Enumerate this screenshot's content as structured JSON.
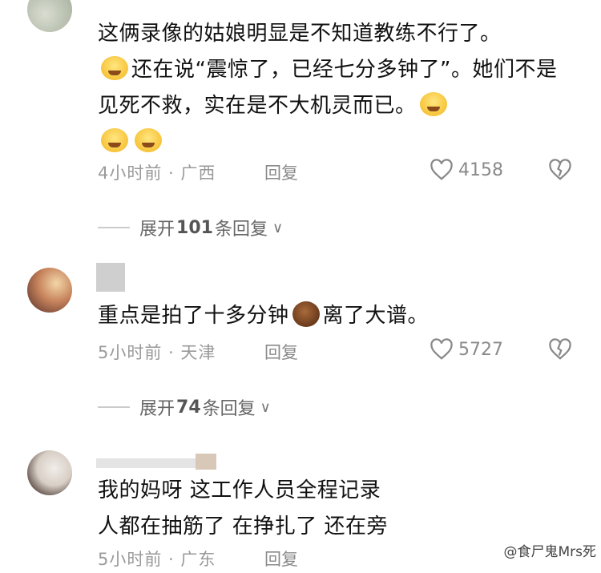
{
  "comments": [
    {
      "text_parts": [
        "这俩录像的姑娘明显是不知道教练不行了。",
        "还在说“震惊了，已经七分多钟了”。她们不是见死不救，实在是不大机灵而已。"
      ],
      "time": "4小时前 · 广西",
      "reply": "回复",
      "likes": "4158",
      "expand": {
        "prefix": "展开",
        "count": "101",
        "suffix": "条回复"
      }
    },
    {
      "text_parts": [
        "重点是拍了十多分钟",
        "离了大谱。"
      ],
      "time": "5小时前 · 天津",
      "reply": "回复",
      "likes": "5727",
      "expand": {
        "prefix": "展开",
        "count": "74",
        "suffix": "条回复"
      }
    },
    {
      "line1": "我的妈呀 这工作人员全程记录",
      "line2": "人都在抽筋了 在挣扎了 还在旁",
      "time": "5小时前 · 广东",
      "reply": "回复"
    }
  ],
  "watermark": "@食尸鬼Mrs死"
}
